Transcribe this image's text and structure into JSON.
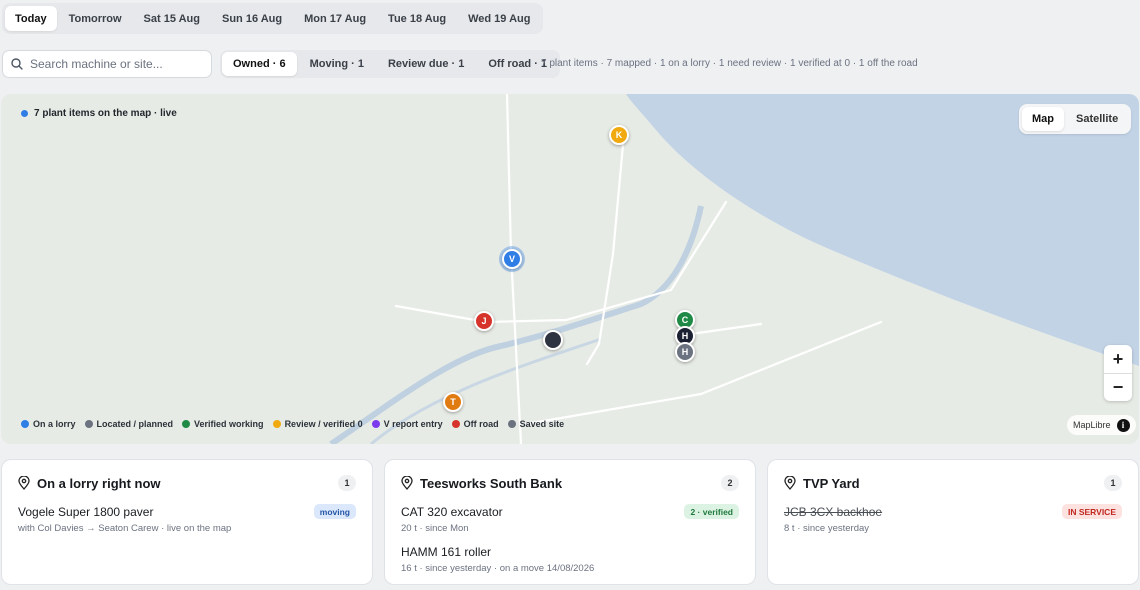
{
  "day_tabs": [
    "Today",
    "Tomorrow",
    "Sat 15 Aug",
    "Sun 16 Aug",
    "Mon 17 Aug",
    "Tue 18 Aug",
    "Wed 19 Aug"
  ],
  "search": {
    "placeholder": "Search machine or site..."
  },
  "filters": [
    "Owned · 6",
    "Moving · 1",
    "Review due · 1",
    "Off road · 1"
  ],
  "summary": "7 plant items · 7 mapped · 1 on a lorry · 1 need review · 1 verified at 0 · 1 off the road",
  "map": {
    "live_label": "7 plant items on the map · live",
    "view_options": [
      "Map",
      "Satellite"
    ],
    "active_view": "Map",
    "zoom_in": "+",
    "zoom_out": "−",
    "attribution": "MapLibre",
    "info": "i",
    "pins": [
      {
        "label": "K",
        "color": "#f0a90f"
      },
      {
        "label": "V",
        "color": "#2f7ee6"
      },
      {
        "label": "J",
        "color": "#d6332b"
      },
      {
        "label": "",
        "color": "#2d3340"
      },
      {
        "label": "C",
        "color": "#1f8a45"
      },
      {
        "label": "H",
        "color": "#1c2033"
      },
      {
        "label": "H",
        "color": "#6b7280"
      },
      {
        "label": "T",
        "color": "#e07b12"
      }
    ],
    "legend": [
      {
        "label": "On a lorry",
        "color": "#2f7ee6"
      },
      {
        "label": "Located / planned",
        "color": "#6b7280"
      },
      {
        "label": "Verified working",
        "color": "#1f8a45"
      },
      {
        "label": "Review / verified 0",
        "color": "#f0a90f"
      },
      {
        "label": "V report entry",
        "color": "#7c3aed"
      },
      {
        "label": "Off road",
        "color": "#d6332b"
      },
      {
        "label": "Saved site",
        "color": "#6b7280"
      }
    ]
  },
  "cards": [
    {
      "title": "On a lorry right now",
      "count": "1",
      "rows": [
        {
          "title": "Vogele Super 1800 paver",
          "sub": "with Col Davies → Seaton Carew · live on the map",
          "badge": "moving",
          "struck": false
        }
      ]
    },
    {
      "title": "Teesworks South Bank",
      "count": "2",
      "rows": [
        {
          "title": "CAT 320 excavator",
          "sub": "20 t · since Mon",
          "badge": "2 · verified",
          "struck": false
        },
        {
          "title": "HAMM 161 roller",
          "sub": "16 t · since yesterday · on a move 14/08/2026",
          "badge": "",
          "struck": false
        }
      ]
    },
    {
      "title": "TVP Yard",
      "count": "1",
      "rows": [
        {
          "title": "JCB 3CX backhoe",
          "sub": "8 t · since yesterday",
          "badge": "IN SERVICE",
          "struck": true
        }
      ]
    }
  ],
  "colors": {
    "badge_moving_bg": "#dbe8fb",
    "badge_moving_fg": "#2456a6",
    "badge_verified_bg": "#dcf3e3",
    "badge_verified_fg": "#1f7a3e",
    "badge_service_bg": "#fde2e0",
    "badge_service_fg": "#c0281f",
    "water": "#c2d3e6",
    "land": "#e7ebe5"
  }
}
